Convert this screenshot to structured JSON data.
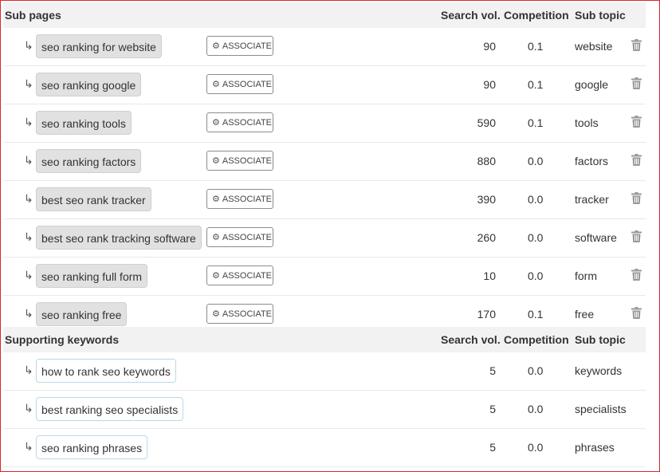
{
  "sub_pages": {
    "title": "Sub pages",
    "col_volume": "Search vol.",
    "col_competition": "Competition",
    "col_subtopic": "Sub topic",
    "associate_label": "ASSOCIATE",
    "rows": [
      {
        "keyword": "seo ranking for website",
        "volume": "90",
        "competition": "0.1",
        "subtopic": "website"
      },
      {
        "keyword": "seo ranking google",
        "volume": "90",
        "competition": "0.1",
        "subtopic": "google"
      },
      {
        "keyword": "seo ranking tools",
        "volume": "590",
        "competition": "0.1",
        "subtopic": "tools"
      },
      {
        "keyword": "seo ranking factors",
        "volume": "880",
        "competition": "0.0",
        "subtopic": "factors"
      },
      {
        "keyword": "best seo rank tracker",
        "volume": "390",
        "competition": "0.0",
        "subtopic": "tracker"
      },
      {
        "keyword": "best seo rank tracking software",
        "volume": "260",
        "competition": "0.0",
        "subtopic": "software"
      },
      {
        "keyword": "seo ranking full form",
        "volume": "10",
        "competition": "0.0",
        "subtopic": "form"
      },
      {
        "keyword": "seo ranking free",
        "volume": "170",
        "competition": "0.1",
        "subtopic": "free"
      }
    ]
  },
  "supporting": {
    "title": "Supporting keywords",
    "col_volume": "Search vol.",
    "col_competition": "Competition",
    "col_subtopic": "Sub topic",
    "rows": [
      {
        "keyword": "how to rank seo keywords",
        "volume": "5",
        "competition": "0.0",
        "subtopic": "keywords"
      },
      {
        "keyword": "best ranking seo specialists",
        "volume": "5",
        "competition": "0.0",
        "subtopic": "specialists"
      },
      {
        "keyword": "seo ranking phrases",
        "volume": "5",
        "competition": "0.0",
        "subtopic": "phrases"
      }
    ]
  },
  "icons": {
    "row_arrow": "subdirectory-arrow-icon",
    "gear": "gear-icon",
    "trash": "trash-icon"
  },
  "colors": {
    "frame": "#d8282c",
    "header_bg": "#f2f2f2",
    "pill_grey": "#e1e1e1",
    "pill_border_blue": "#b9d9e6"
  }
}
